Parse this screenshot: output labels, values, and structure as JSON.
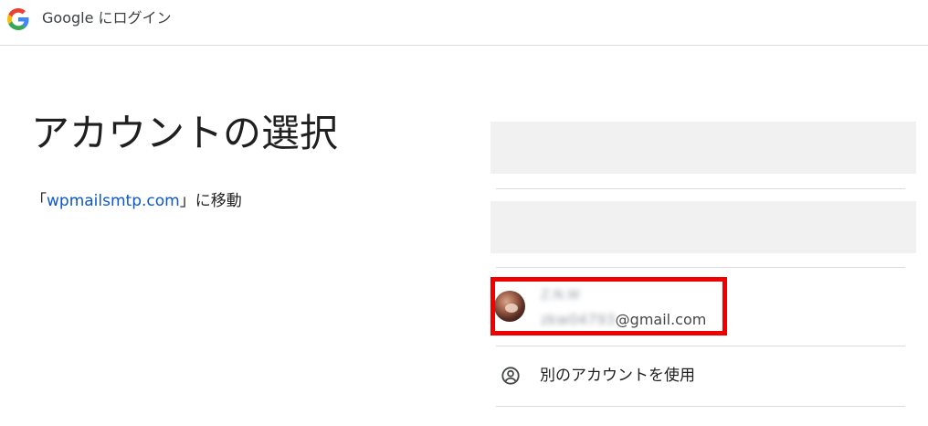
{
  "header": {
    "brand": "Google",
    "title": "にログイン"
  },
  "main": {
    "title": "アカウントの選択",
    "continue_prefix": "「",
    "continue_link": "wpmailsmtp.com",
    "continue_suffix": "」に移動"
  },
  "accounts": {
    "selected": {
      "name": "Z.N.W",
      "email_user": "zkw04793",
      "email_domain": "@gmail.com"
    },
    "other_account_label": "別のアカウントを使用"
  },
  "colors": {
    "link": "#0b57d0",
    "highlight": "#ee0000",
    "placeholder": "#f1f1f1",
    "divider": "#dadce0"
  }
}
